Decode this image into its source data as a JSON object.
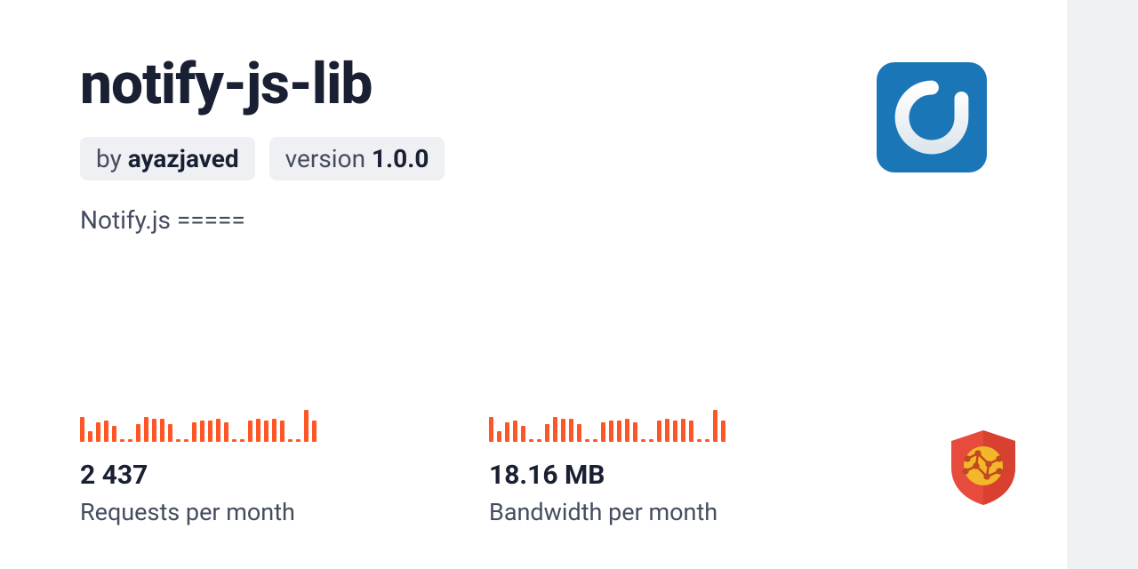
{
  "package": {
    "name": "notify-js-lib",
    "author_prefix": "by ",
    "author": "ayazjaved",
    "version_prefix": "version ",
    "version": "1.0.0",
    "description": "Notify.js ====="
  },
  "stats": {
    "requests": {
      "value": "2 437",
      "label": "Requests per month",
      "spark": [
        28,
        12,
        22,
        24,
        18,
        3,
        3,
        20,
        28,
        26,
        26,
        20,
        3,
        3,
        22,
        24,
        24,
        26,
        22,
        3,
        3,
        24,
        26,
        24,
        26,
        24,
        3,
        3,
        36,
        24
      ]
    },
    "bandwidth": {
      "value": "18.16 MB",
      "label": "Bandwidth per month",
      "spark": [
        28,
        12,
        22,
        24,
        18,
        3,
        3,
        20,
        28,
        26,
        26,
        20,
        3,
        3,
        22,
        24,
        24,
        26,
        22,
        3,
        3,
        24,
        26,
        24,
        26,
        24,
        3,
        3,
        36,
        24
      ]
    }
  },
  "colors": {
    "accent": "#ff5627",
    "avatar_bg": "#1b76b8",
    "shield": "#e74b3c",
    "globe": "#f2b72a"
  }
}
